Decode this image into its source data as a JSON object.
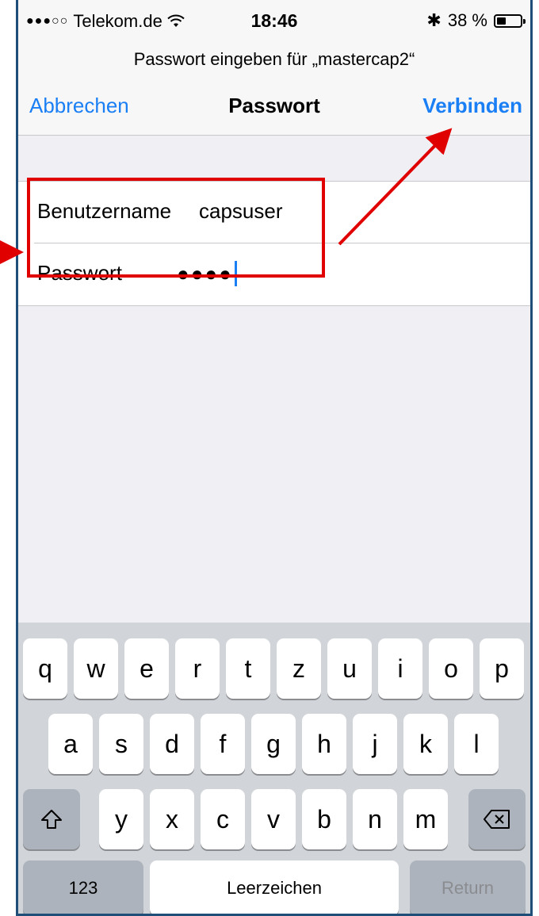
{
  "status_bar": {
    "signal": "●●●○○",
    "carrier": "Telekom.de",
    "wifi_icon": "wifi-icon",
    "time": "18:46",
    "bluetooth": "✱",
    "battery_text": "38 %",
    "battery_level": 0.38
  },
  "prompt": "Passwort eingeben für „mastercap2“",
  "nav": {
    "cancel": "Abbrechen",
    "title": "Passwort",
    "connect": "Verbinden"
  },
  "form": {
    "username_label": "Benutzername",
    "username_value": "capsuser",
    "password_label": "Passwort",
    "password_value": "●●●●"
  },
  "keyboard": {
    "row1": [
      "q",
      "w",
      "e",
      "r",
      "t",
      "z",
      "u",
      "i",
      "o",
      "p"
    ],
    "row2": [
      "a",
      "s",
      "d",
      "f",
      "g",
      "h",
      "j",
      "k",
      "l"
    ],
    "row3": [
      "y",
      "x",
      "c",
      "v",
      "b",
      "n",
      "m"
    ],
    "shift": "⇧",
    "delete": "⌫",
    "numbers": "123",
    "space": "Leerzeichen",
    "return": "Return"
  },
  "annotation_color": "#e00000"
}
